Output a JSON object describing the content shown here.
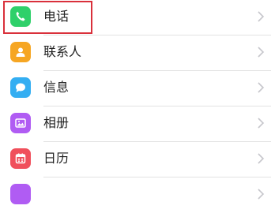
{
  "settings": {
    "items": [
      {
        "label": "电话",
        "icon": "phone-icon",
        "color": "#2fd06a"
      },
      {
        "label": "联系人",
        "icon": "contacts-icon",
        "color": "#f6a623"
      },
      {
        "label": "信息",
        "icon": "message-icon",
        "color": "#34aef2"
      },
      {
        "label": "相册",
        "icon": "photos-icon",
        "color": "#b05cf3"
      },
      {
        "label": "日历",
        "icon": "calendar-icon",
        "color": "#f0505c"
      },
      {
        "label": "",
        "icon": "partial-icon",
        "color": "#b05cf3"
      }
    ],
    "highlight_color": "#d9303b"
  }
}
